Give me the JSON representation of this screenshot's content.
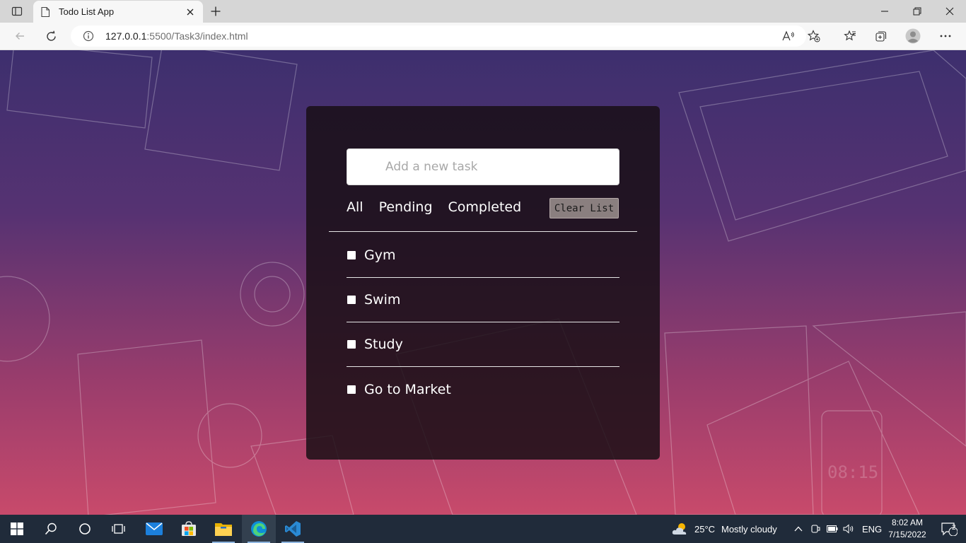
{
  "browser": {
    "tab_title": "Todo List App",
    "url_host": "127.0.0.1",
    "url_rest": ":5500/Task3/index.html"
  },
  "app": {
    "input_placeholder": "Add a new task",
    "filters": [
      "All",
      "Pending",
      "Completed"
    ],
    "clear_label": "Clear List",
    "tasks": [
      "Gym",
      "Swim",
      "Study",
      "Go to Market"
    ]
  },
  "taskbar": {
    "temperature": "25°C",
    "weather": "Mostly cloudy",
    "language": "ENG",
    "time": "8:02 AM",
    "date": "7/15/2022",
    "notifications": "2"
  },
  "icons": {
    "tab_actions": "tab-actions-icon",
    "page": "page-icon",
    "close": "close-icon",
    "new_tab": "plus-icon",
    "minimize": "minimize-icon",
    "restore": "restore-icon",
    "close_window": "close-window-icon",
    "back": "back-arrow-icon",
    "refresh": "refresh-icon",
    "info": "info-icon",
    "read_aloud": "read-aloud-icon",
    "add_favorite": "add-favorite-icon",
    "favorites": "favorites-icon",
    "collections": "collections-icon",
    "profile": "profile-icon",
    "menu": "more-menu-icon",
    "start": "windows-start-icon",
    "search": "search-icon",
    "cortana": "cortana-icon",
    "task_view": "task-view-icon",
    "mail": "mail-icon",
    "store": "store-icon",
    "explorer": "file-explorer-icon",
    "edge": "edge-icon",
    "vscode": "vscode-icon",
    "weather": "weather-icon",
    "chevron_up": "chevron-up-icon",
    "meet_now": "meet-now-icon",
    "battery": "battery-icon",
    "volume": "volume-icon",
    "notification": "notification-icon"
  },
  "colors": {
    "card_bg": "#180e14",
    "clear_button": "#8a7f7f",
    "taskbar_bg": "#202b3a"
  }
}
